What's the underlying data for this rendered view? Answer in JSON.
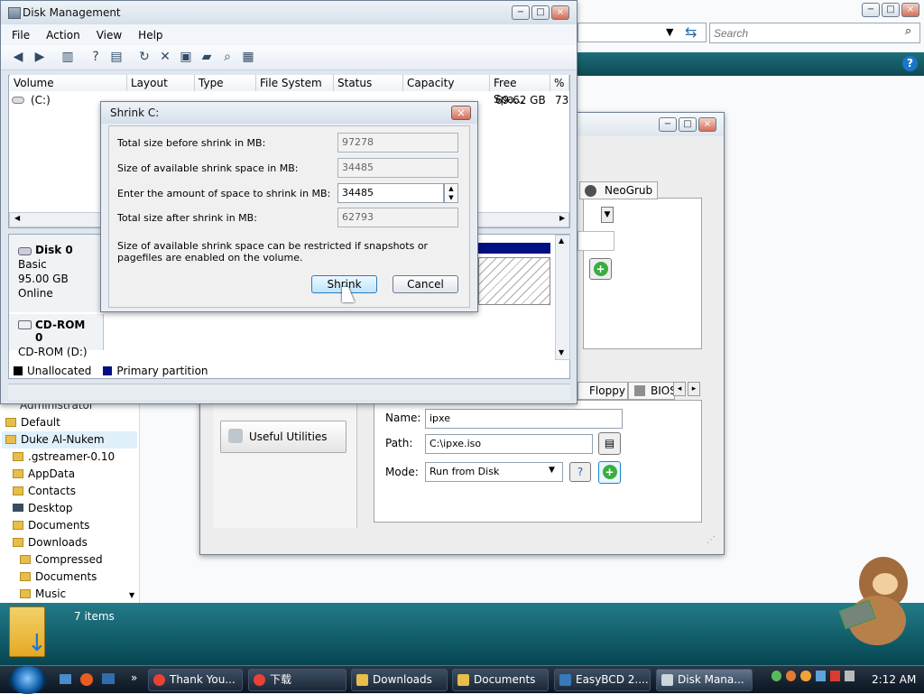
{
  "desktop": {
    "search_placeholder": "Search",
    "help_icon": "help-icon",
    "items_count": "7 items",
    "nav_items": [
      "Administrator",
      "Default",
      "Duke Al-Nukem",
      ".gstreamer-0.10",
      "AppData",
      "Contacts",
      "Desktop",
      "Documents",
      "Downloads",
      "Compressed",
      "Documents",
      "Music"
    ]
  },
  "disk": {
    "title": "Disk Management",
    "menu": [
      "File",
      "Action",
      "View",
      "Help"
    ],
    "headers": [
      "Volume",
      "Layout",
      "Type",
      "File System",
      "Status",
      "Capacity",
      "Free Spa...",
      "% F"
    ],
    "volume": "(C:)",
    "free": "69.62 GB",
    "percent": "73",
    "disk0": {
      "title": "Disk 0",
      "type": "Basic",
      "size": "95.00 GB",
      "state": "Online"
    },
    "cdrom": {
      "title": "CD-ROM 0",
      "drive": "CD-ROM (D:)"
    },
    "legend": [
      "Unallocated",
      "Primary partition"
    ]
  },
  "shrink": {
    "title": "Shrink C:",
    "labels": [
      "Total size before shrink in MB:",
      "Size of available shrink space in MB:",
      "Enter the amount of space to shrink in MB:",
      "Total size after shrink in MB:"
    ],
    "values": [
      "97278",
      "34485",
      "34485",
      "62793"
    ],
    "note": "Size of available shrink space can be restricted if snapshots or pagefiles are enabled on the volume.",
    "shrink_button": "Shrink",
    "cancel_button": "Cancel"
  },
  "easybcd": {
    "tab": "NeoGrub",
    "floppy": "Floppy",
    "bios": "BIOS",
    "utilities": "Useful Utilities",
    "name_label": "Name:",
    "name_value": "ipxe",
    "path_label": "Path:",
    "path_value": "C:\\ipxe.iso",
    "mode_label": "Mode:",
    "mode_value": "Run from Disk"
  },
  "taskbar": {
    "items": [
      "Thank You...",
      "下载",
      "Downloads",
      "Documents",
      "EasyBCD 2....",
      "Disk Mana..."
    ],
    "time": "2:12 AM",
    "expand": "»"
  }
}
